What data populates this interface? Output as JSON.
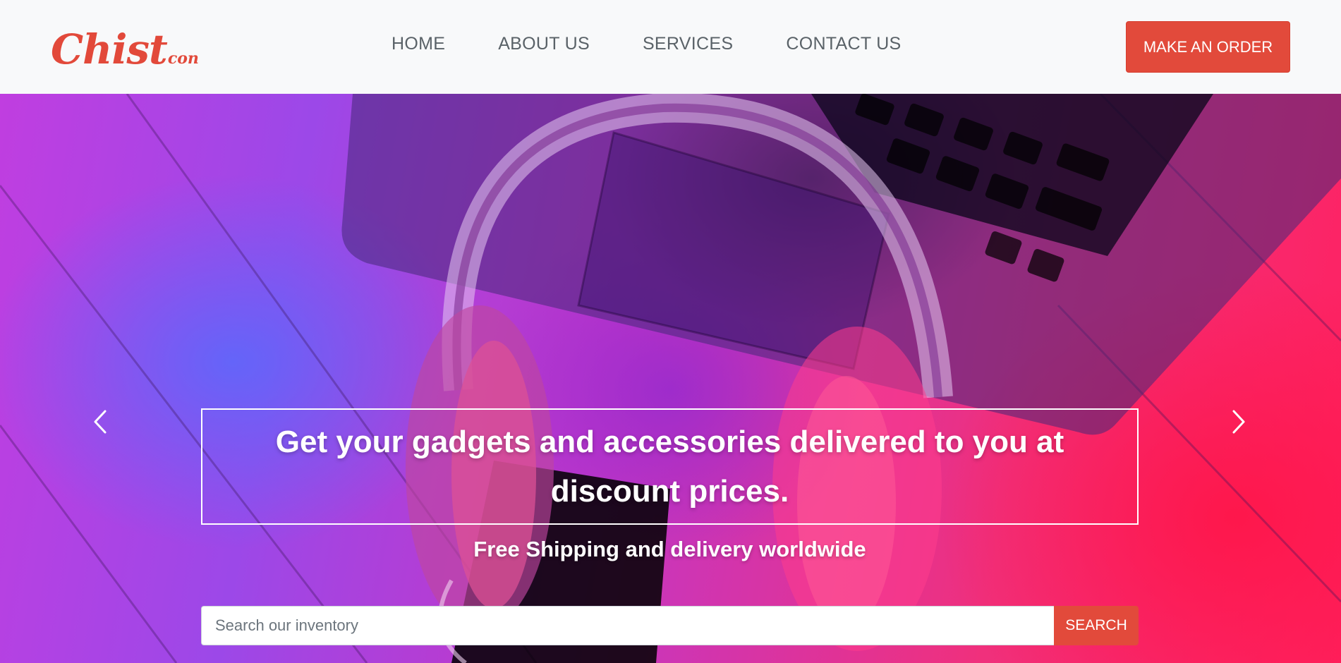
{
  "brand": {
    "main": "Chist",
    "sub": "con",
    "color": "#e2493a"
  },
  "nav": {
    "items": [
      {
        "label": "HOME"
      },
      {
        "label": "ABOUT US"
      },
      {
        "label": "SERVICES"
      },
      {
        "label": "CONTACT US"
      }
    ],
    "cta_label": "MAKE AN ORDER"
  },
  "hero": {
    "headline": "Get your gadgets and accessories delivered to you at discount prices.",
    "subheadline": "Free Shipping and delivery worldwide",
    "prev_icon": "chevron-left-icon",
    "next_icon": "chevron-right-icon"
  },
  "search": {
    "placeholder": "Search our inventory",
    "value": "",
    "button_label": "SEARCH"
  },
  "colors": {
    "accent": "#e24a3b",
    "navbar_bg": "#f8f9fa",
    "nav_text": "#5a6268"
  }
}
